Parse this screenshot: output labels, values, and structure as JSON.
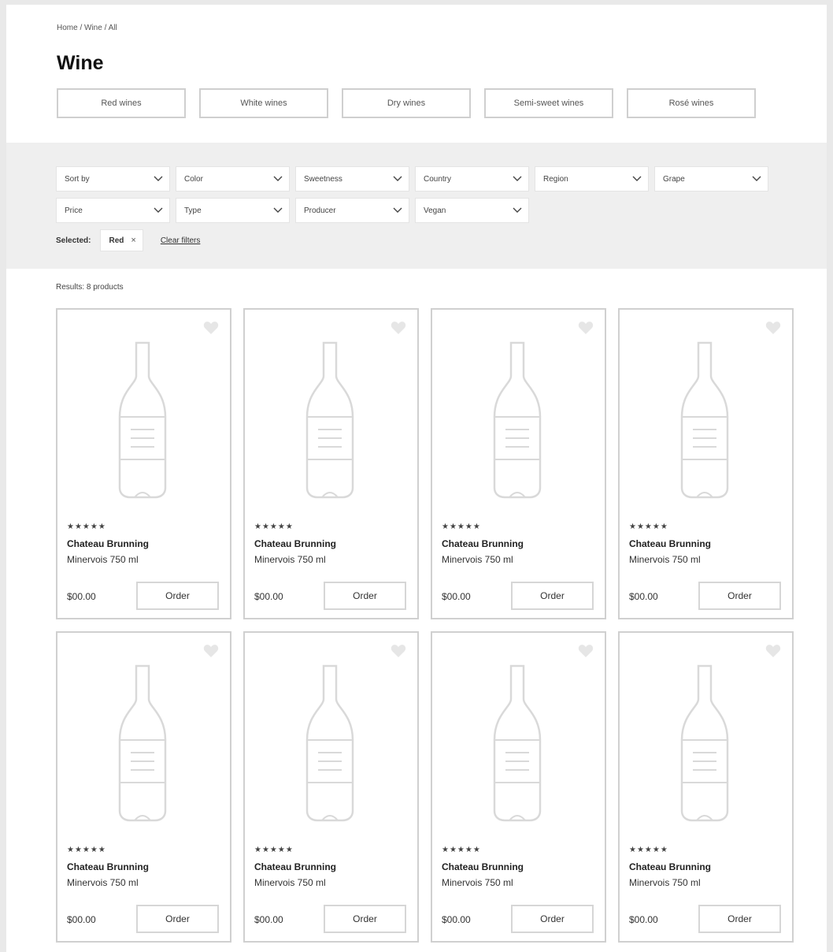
{
  "breadcrumb": "Home / Wine / All",
  "page_title": "Wine",
  "categories": [
    "Red wines",
    "White wines",
    "Dry wines",
    "Semi-sweet wines",
    "Rosé wines"
  ],
  "filters": {
    "row1": [
      "Sort by",
      "Color",
      "Sweetness",
      "Country",
      "Region",
      "Grape"
    ],
    "row2": [
      "Price",
      "Type",
      "Producer",
      "Vegan"
    ]
  },
  "selected": {
    "label": "Selected:",
    "chip": "Red",
    "chip_close": "×",
    "clear_label": "Clear filters"
  },
  "results": {
    "count_label": "Results: 8 products"
  },
  "products": [
    {
      "stars": "★★★★★",
      "name": "Chateau Brunning",
      "desc": "Minervois 750 ml",
      "price": "$00.00",
      "order_label": "Order"
    },
    {
      "stars": "★★★★★",
      "name": "Chateau Brunning",
      "desc": "Minervois 750 ml",
      "price": "$00.00",
      "order_label": "Order"
    },
    {
      "stars": "★★★★★",
      "name": "Chateau Brunning",
      "desc": "Minervois 750 ml",
      "price": "$00.00",
      "order_label": "Order"
    },
    {
      "stars": "★★★★★",
      "name": "Chateau Brunning",
      "desc": "Minervois 750 ml",
      "price": "$00.00",
      "order_label": "Order"
    },
    {
      "stars": "★★★★★",
      "name": "Chateau Brunning",
      "desc": "Minervois 750 ml",
      "price": "$00.00",
      "order_label": "Order"
    },
    {
      "stars": "★★★★★",
      "name": "Chateau Brunning",
      "desc": "Minervois 750 ml",
      "price": "$00.00",
      "order_label": "Order"
    },
    {
      "stars": "★★★★★",
      "name": "Chateau Brunning",
      "desc": "Minervois 750 ml",
      "price": "$00.00",
      "order_label": "Order"
    },
    {
      "stars": "★★★★★",
      "name": "Chateau Brunning",
      "desc": "Minervois 750 ml",
      "price": "$00.00",
      "order_label": "Order"
    }
  ],
  "icons": {
    "favorite": "heart-icon",
    "dropdown": "chevron-down-icon",
    "product_image": "wine-bottle-icon"
  }
}
